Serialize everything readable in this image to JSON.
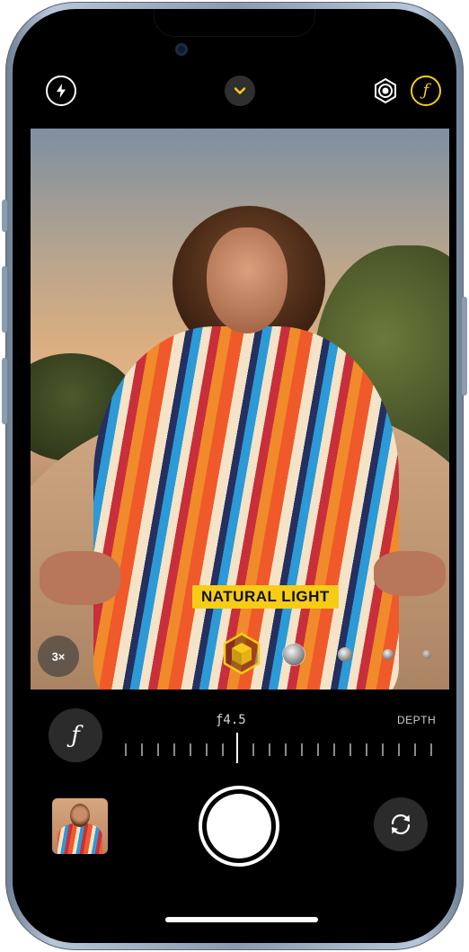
{
  "top_bar": {
    "flash_icon": "flash-bolt-icon",
    "chevron_icon": "chevron-down-icon",
    "live_icon": "live-photo-icon",
    "fstop_toggle_icon": "aperture-f-icon",
    "fstop_toggle_glyph": "ƒ",
    "accent_color": "#f7cc16"
  },
  "viewfinder": {
    "lighting_effect_label": "NATURAL LIGHT",
    "zoom_label": "3×",
    "lighting_options": [
      "natural-light-cube-icon",
      "studio-light-dot",
      "contour-light-dot",
      "stage-light-dot",
      "stage-light-mono-dot"
    ]
  },
  "depth_control": {
    "fstop_button_glyph": "ƒ",
    "fstop_value": "ƒ4.5",
    "depth_label": "DEPTH"
  },
  "bottom_bar": {
    "thumbnail_icon": "last-photo-thumbnail",
    "shutter_icon": "shutter-button",
    "flip_icon": "camera-flip-icon"
  }
}
